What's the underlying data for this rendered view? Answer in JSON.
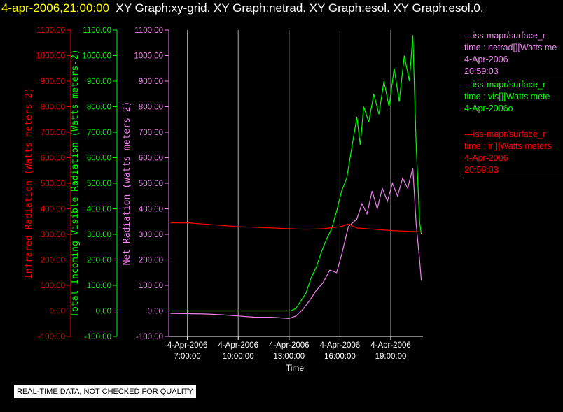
{
  "header": {
    "timestamp": "4-apr-2006,21:00:00",
    "graphs": "XY Graph:xy-grid.  XY Graph:netrad.  XY Graph:esol.  XY Graph:esol.0."
  },
  "legend": [
    {
      "id": "netrad",
      "source": "---iss-mapr/surface_r",
      "variable": "time : netrad[][Watts me",
      "date": "4-Apr-2006",
      "time": "20:59:03",
      "color": "#ee82ee"
    },
    {
      "id": "vis",
      "source": "---iss-mapr/surface_r",
      "variable": "time : vis[][Watts mete",
      "date": "4-Apr-2006o",
      "time": "",
      "color": "#00ff00"
    },
    {
      "id": "ir",
      "source": "---iss-mapr/surface_r",
      "variable": "time : ir[][Watts meters",
      "date": "4-Apr-2006",
      "time": "20:59:03",
      "color": "#ff0000"
    }
  ],
  "notice": "REAL-TIME DATA, NOT CHECKED FOR QUALITY",
  "chart_data": {
    "type": "line",
    "xlabel": "Time",
    "x_ticks": [
      {
        "t": 7,
        "line1": "4-Apr-2006",
        "line2": "7:00:00"
      },
      {
        "t": 10,
        "line1": "4-Apr-2006",
        "line2": "10:00:00"
      },
      {
        "t": 13,
        "line1": "4-Apr-2006",
        "line2": "13:00:00"
      },
      {
        "t": 16,
        "line1": "4-Apr-2006",
        "line2": "16:00:00"
      },
      {
        "t": 19,
        "line1": "4-Apr-2006",
        "line2": "19:00:00"
      }
    ],
    "xlim": [
      5.9,
      20.9
    ],
    "ylim": [
      -100,
      1100
    ],
    "y_ticks": [
      "-100.00",
      "0.00",
      "100.00",
      "200.00",
      "300.00",
      "400.00",
      "500.00",
      "600.00",
      "700.00",
      "800.00",
      "900.00",
      "1000.00",
      "1100.00"
    ],
    "axes": [
      {
        "id": "ir",
        "label": "Infrared Radiation (Watts meters-2)",
        "color": "#ff0000"
      },
      {
        "id": "vis",
        "label": "Total Incoming Visible Radiation (Watts meters-2)",
        "color": "#00ff00"
      },
      {
        "id": "net",
        "label": "Net Radiation (watts meters-2)",
        "color": "#ee82ee"
      }
    ],
    "grid": "vertical lines at x ticks",
    "series": [
      {
        "name": "vis",
        "color": "#00ff00",
        "points": [
          [
            6,
            0
          ],
          [
            8,
            0
          ],
          [
            10,
            0
          ],
          [
            12,
            0
          ],
          [
            13.1,
            0
          ],
          [
            13.4,
            10
          ],
          [
            13.7,
            40
          ],
          [
            14,
            70
          ],
          [
            14.3,
            130
          ],
          [
            14.6,
            170
          ],
          [
            14.9,
            230
          ],
          [
            15.2,
            280
          ],
          [
            15.5,
            320
          ],
          [
            15.8,
            390
          ],
          [
            16.1,
            470
          ],
          [
            16.4,
            520
          ],
          [
            16.7,
            640
          ],
          [
            17,
            760
          ],
          [
            17.2,
            650
          ],
          [
            17.4,
            800
          ],
          [
            17.7,
            740
          ],
          [
            18,
            850
          ],
          [
            18.3,
            770
          ],
          [
            18.6,
            900
          ],
          [
            18.9,
            800
          ],
          [
            19.2,
            950
          ],
          [
            19.5,
            820
          ],
          [
            19.8,
            1000
          ],
          [
            20.1,
            900
          ],
          [
            20.3,
            1080
          ],
          [
            20.5,
            650
          ],
          [
            20.7,
            350
          ],
          [
            20.8,
            300
          ]
        ]
      },
      {
        "name": "netrad",
        "color": "#ee82ee",
        "points": [
          [
            6,
            -10
          ],
          [
            8,
            -12
          ],
          [
            9,
            -15
          ],
          [
            10,
            -20
          ],
          [
            11,
            -25
          ],
          [
            12,
            -25
          ],
          [
            13,
            -30
          ],
          [
            13.4,
            -20
          ],
          [
            13.8,
            5
          ],
          [
            14.2,
            40
          ],
          [
            14.6,
            80
          ],
          [
            15,
            110
          ],
          [
            15.4,
            160
          ],
          [
            15.8,
            150
          ],
          [
            16.1,
            220
          ],
          [
            16.5,
            330
          ],
          [
            17,
            360
          ],
          [
            17.3,
            420
          ],
          [
            17.6,
            380
          ],
          [
            17.9,
            470
          ],
          [
            18.2,
            400
          ],
          [
            18.5,
            480
          ],
          [
            18.8,
            430
          ],
          [
            19.1,
            500
          ],
          [
            19.4,
            450
          ],
          [
            19.7,
            520
          ],
          [
            20,
            480
          ],
          [
            20.3,
            560
          ],
          [
            20.5,
            340
          ],
          [
            20.7,
            200
          ],
          [
            20.8,
            120
          ]
        ]
      },
      {
        "name": "ir",
        "color": "#ff0000",
        "points": [
          [
            6,
            345
          ],
          [
            7,
            345
          ],
          [
            8,
            340
          ],
          [
            9,
            335
          ],
          [
            10,
            330
          ],
          [
            11,
            328
          ],
          [
            12,
            325
          ],
          [
            13,
            322
          ],
          [
            14,
            320
          ],
          [
            15,
            322
          ],
          [
            16,
            330
          ],
          [
            16.5,
            340
          ],
          [
            17,
            325
          ],
          [
            18,
            320
          ],
          [
            19,
            315
          ],
          [
            20,
            312
          ],
          [
            20.8,
            310
          ]
        ]
      }
    ]
  }
}
